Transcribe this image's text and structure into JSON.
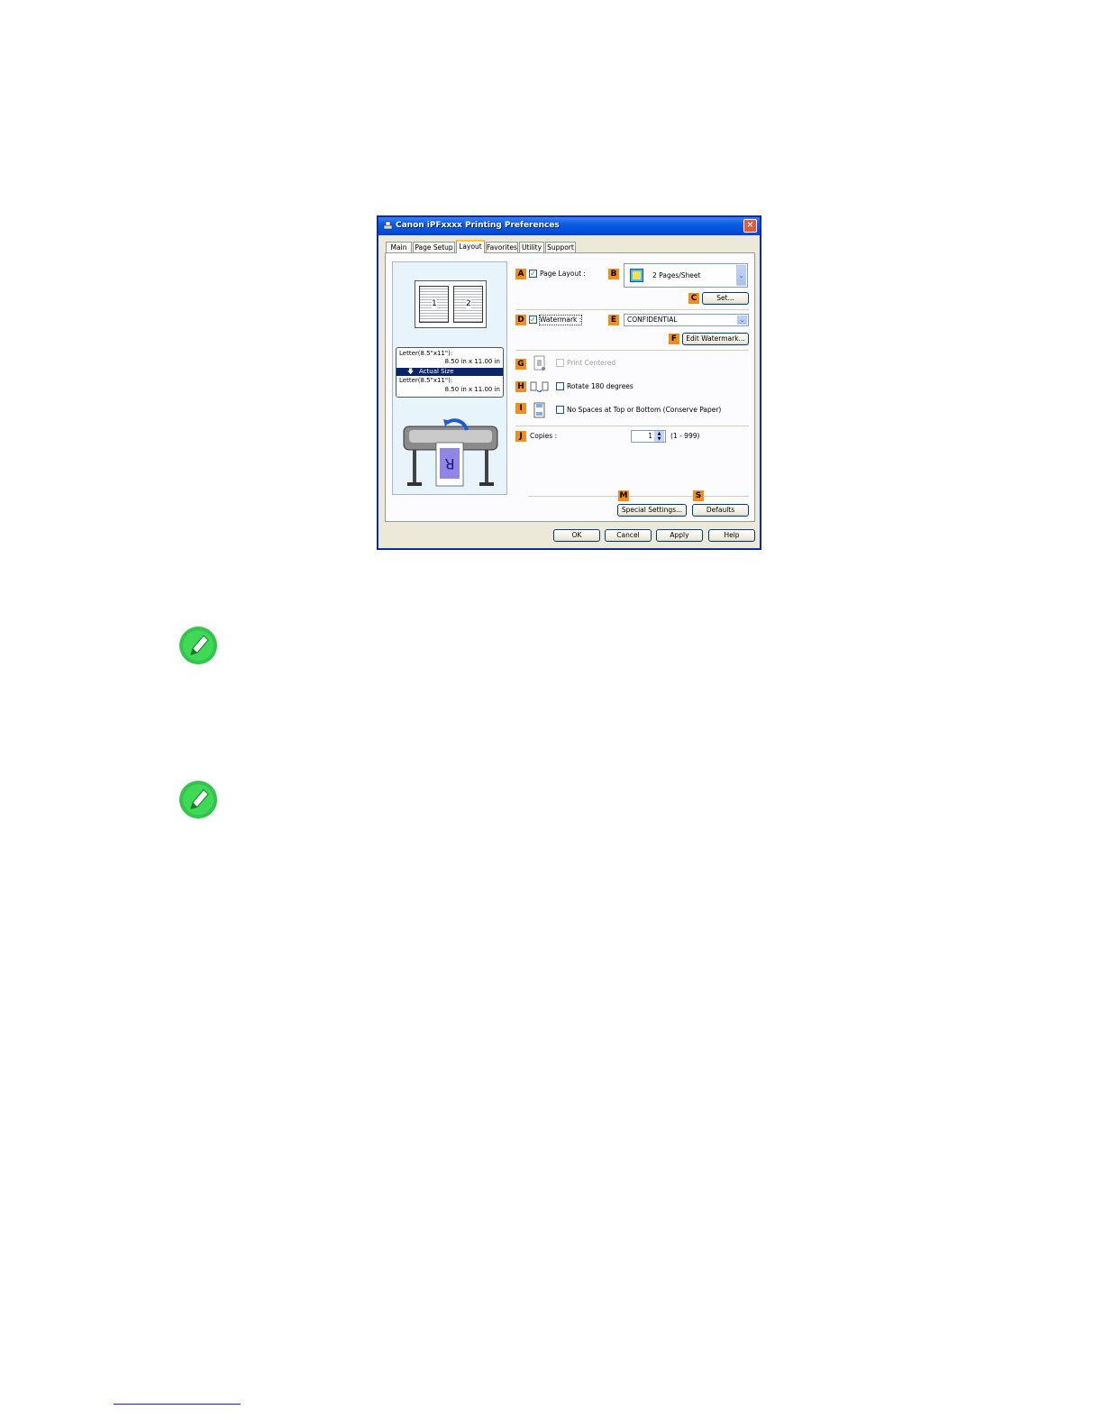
{
  "dialog": {
    "title": "Canon iPFxxxx Printing Preferences",
    "close_glyph": "×",
    "tabs": [
      {
        "label": "Main"
      },
      {
        "label": "Page Setup"
      },
      {
        "label": "Layout"
      },
      {
        "label": "Favorites"
      },
      {
        "label": "Utility"
      },
      {
        "label": "Support"
      }
    ],
    "active_tab": "Layout",
    "preview": {
      "page_numbers": [
        "1",
        "2"
      ],
      "info_line1": "Letter(8.5\"x11\"):",
      "info_line2": "8.50 in x 11.00 in",
      "info_selected": "Actual Size",
      "info_line3": "Letter(8.5\"x11\"):",
      "info_line4": "8.50 in x 11.00 in",
      "printer_sheet_letter": "R"
    },
    "badges": {
      "a": "A",
      "b": "B",
      "c": "C",
      "d": "D",
      "e": "E",
      "f": "F",
      "g": "G",
      "h": "H",
      "i": "I",
      "j": "J",
      "m": "M",
      "s": "S"
    },
    "page_layout": {
      "label": "Page Layout :",
      "checked": true,
      "value": "2 Pages/Sheet",
      "set_button": "Set..."
    },
    "watermark": {
      "label": "Watermark :",
      "checked": true,
      "value": "CONFIDENTIAL",
      "edit_button": "Edit Watermark..."
    },
    "print_centered": {
      "label": "Print Centered",
      "checked": false,
      "enabled": false
    },
    "rotate": {
      "label": "Rotate 180 degrees",
      "checked": false
    },
    "no_spaces": {
      "label": "No Spaces at Top or Bottom (Conserve Paper)",
      "checked": false
    },
    "copies": {
      "label": "Copies :",
      "value": "1",
      "range": "(1 - 999)"
    },
    "special_settings_button": "Special Settings...",
    "defaults_button": "Defaults",
    "footer_buttons": {
      "ok": "OK",
      "cancel": "Cancel",
      "apply": "Apply",
      "help": "Help"
    }
  },
  "colors": {
    "title_bar": "#0a5ce0",
    "badge": "#f0901a",
    "note_icon": "#34c34b",
    "footer_link_rule": "#1a1aff"
  },
  "icons": [
    "printer-app-icon",
    "close-icon",
    "pencil-note-icon",
    "chevron-down-icon",
    "spin-up-icon",
    "spin-down-icon"
  ]
}
